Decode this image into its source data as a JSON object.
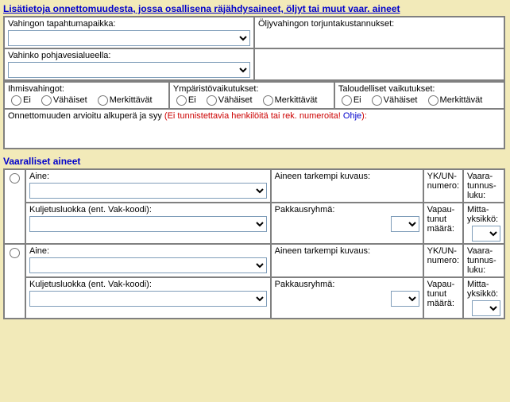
{
  "s1": {
    "title": "Lisätietoja onnettomuudesta, jossa osallisena räjähdysaineet, öljyt tai muut vaar. aineet",
    "vahinko_tapahtumapaikka": "Vahingon tapahtumapaikka:",
    "oljy_torjunta": "Öljyvahingon torjuntakustannukset:",
    "pohjavesi": "Vahinko pohjavesialueella:",
    "ihmisvahingot": "Ihmisvahingot:",
    "ymparisto": "Ympäristövaikutukset:",
    "taloudelliset": "Taloudelliset vaikutukset:",
    "ei": "Ei",
    "vahaiset": "Vähäiset",
    "merkittavat": "Merkittävät",
    "arvioitu": "Onnettomuuden arvioitu alkuperä ja syy",
    "arvioitu_note": "(Ei tunnistettavia henkilöitä tai rek. numeroita! ",
    "ohje": "Ohje",
    "close": "):"
  },
  "s2": {
    "title": "Vaaralliset aineet",
    "aine": "Aine:",
    "tarkempi": "Aineen tarkempi kuvaus:",
    "ykun": "YK/UN-numero:",
    "vaara": "Vaara-tunnus-luku:",
    "kuljetus": "Kuljetusluokka (ent. Vak-koodi):",
    "pakkaus": "Pakkausryhmä:",
    "vapautunut": "Vapau-tunut määrä:",
    "mitta": "Mitta-yksikkö:"
  }
}
